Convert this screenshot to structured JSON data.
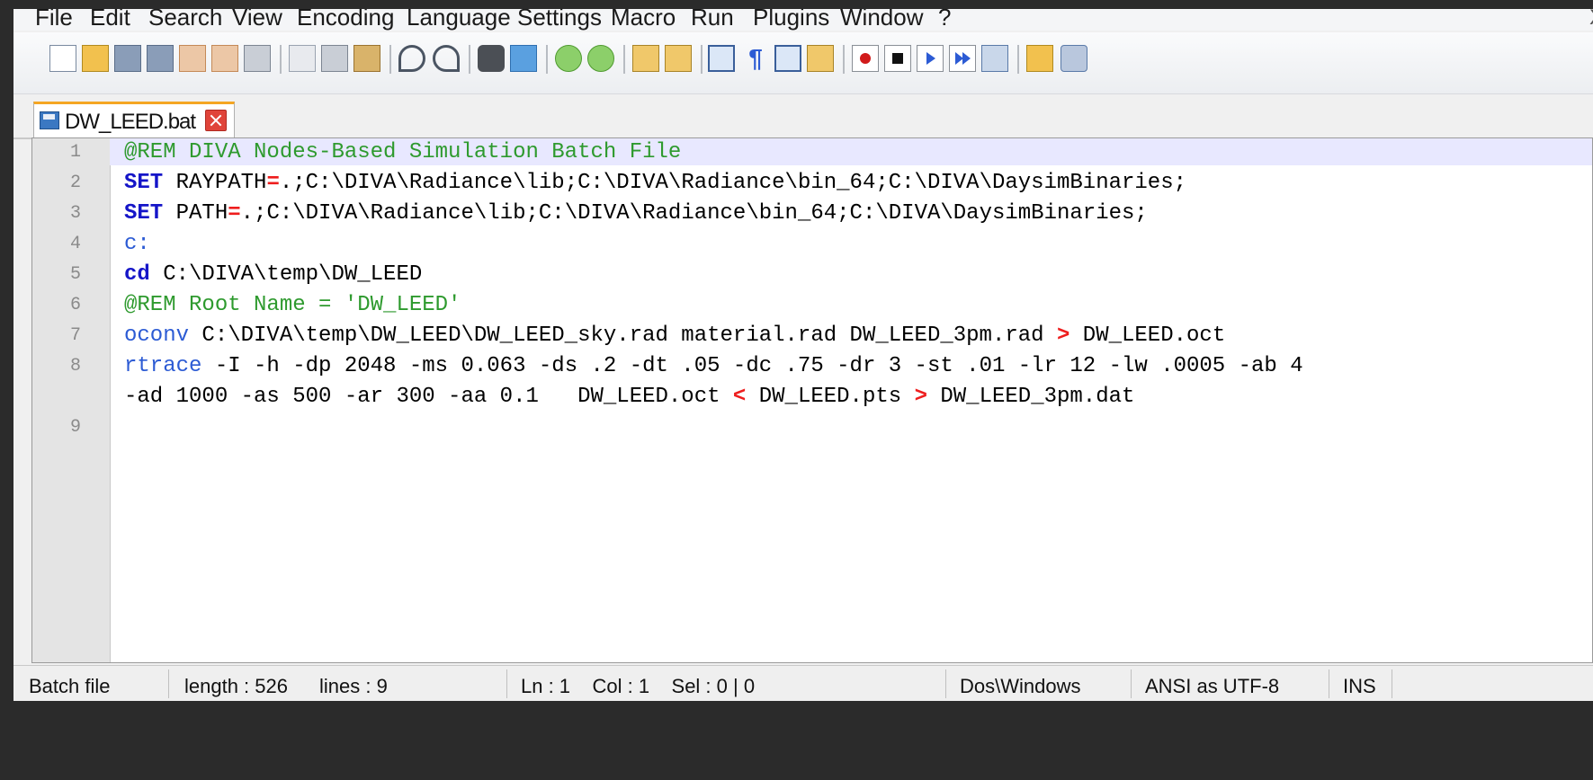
{
  "menu": {
    "items": [
      "File",
      "Edit",
      "Search",
      "View",
      "Encoding",
      "Language",
      "Settings",
      "Macro",
      "Run",
      "Plugins",
      "Window",
      "?"
    ],
    "close_label": "X"
  },
  "toolbar": {
    "icons": [
      "new-file-icon",
      "open-file-icon",
      "save-icon",
      "save-all-icon",
      "close-icon",
      "close-all-icon",
      "print-icon",
      "cut-icon",
      "copy-icon",
      "paste-icon",
      "undo-icon",
      "redo-icon",
      "find-icon",
      "replace-icon",
      "zoom-in-icon",
      "zoom-out-icon",
      "sync-vertical-icon",
      "sync-horizontal-icon",
      "word-wrap-icon",
      "show-all-characters-icon",
      "indent-guide-icon",
      "document-map-icon",
      "record-macro-icon",
      "stop-record-icon",
      "playback-icon",
      "run-macro-multiple-icon",
      "save-macro-icon",
      "folder-icon",
      "spellcheck-icon"
    ]
  },
  "tab": {
    "label": "DW_LEED.bat"
  },
  "editor": {
    "lines": [
      {
        "no": "1",
        "segments": [
          {
            "cls": "c-rem",
            "t": "@REM DIVA Nodes-Based Simulation Batch File"
          }
        ]
      },
      {
        "no": "2",
        "segments": [
          {
            "cls": "c-kw",
            "t": "SET"
          },
          {
            "cls": "c-txt",
            "t": " RAYPATH"
          },
          {
            "cls": "c-op",
            "t": "="
          },
          {
            "cls": "c-txt",
            "t": ".;C:\\DIVA\\Radiance\\lib;C:\\DIVA\\Radiance\\bin_64;C:\\DIVA\\DaysimBinaries;"
          }
        ]
      },
      {
        "no": "3",
        "segments": [
          {
            "cls": "c-kw",
            "t": "SET"
          },
          {
            "cls": "c-txt",
            "t": " PATH"
          },
          {
            "cls": "c-op",
            "t": "="
          },
          {
            "cls": "c-txt",
            "t": ".;C:\\DIVA\\Radiance\\lib;C:\\DIVA\\Radiance\\bin_64;C:\\DIVA\\DaysimBinaries;"
          }
        ]
      },
      {
        "no": "4",
        "segments": [
          {
            "cls": "c-cmd",
            "t": "c:"
          }
        ]
      },
      {
        "no": "5",
        "segments": [
          {
            "cls": "c-kw",
            "t": "cd"
          },
          {
            "cls": "c-txt",
            "t": " C:\\DIVA\\temp\\DW_LEED"
          }
        ]
      },
      {
        "no": "6",
        "segments": [
          {
            "cls": "c-rem",
            "t": "@REM Root Name = 'DW_LEED'"
          }
        ]
      },
      {
        "no": "7",
        "segments": [
          {
            "cls": "c-cmd",
            "t": "oconv"
          },
          {
            "cls": "c-txt",
            "t": " C:\\DIVA\\temp\\DW_LEED\\DW_LEED_sky.rad material.rad DW_LEED_3pm.rad "
          },
          {
            "cls": "c-op",
            "t": ">"
          },
          {
            "cls": "c-txt",
            "t": " DW_LEED.oct"
          }
        ]
      },
      {
        "no": "8",
        "segments": [
          {
            "cls": "c-cmd",
            "t": "rtrace"
          },
          {
            "cls": "c-txt",
            "t": " -I -h -dp 2048 -ms 0.063 -ds .2 -dt .05 -dc .75 -dr 3 -st .01 -lr 12 -lw .0005 -ab 4"
          }
        ]
      },
      {
        "no": "",
        "segments": [
          {
            "cls": "c-txt",
            "t": "-ad 1000 -as 500 -ar 300 -aa 0.1   DW_LEED.oct "
          },
          {
            "cls": "c-op",
            "t": "<"
          },
          {
            "cls": "c-txt",
            "t": " DW_LEED.pts "
          },
          {
            "cls": "c-op",
            "t": ">"
          },
          {
            "cls": "c-txt",
            "t": " DW_LEED_3pm.dat"
          }
        ]
      },
      {
        "no": "9",
        "segments": []
      }
    ]
  },
  "status": {
    "file_type": "Batch file",
    "length": "length : 526",
    "lines": "lines : 9",
    "position": "Ln : 1    Col : 1    Sel : 0 | 0",
    "eol": "Dos\\Windows",
    "encoding": "ANSI as UTF-8",
    "mode": "INS"
  }
}
